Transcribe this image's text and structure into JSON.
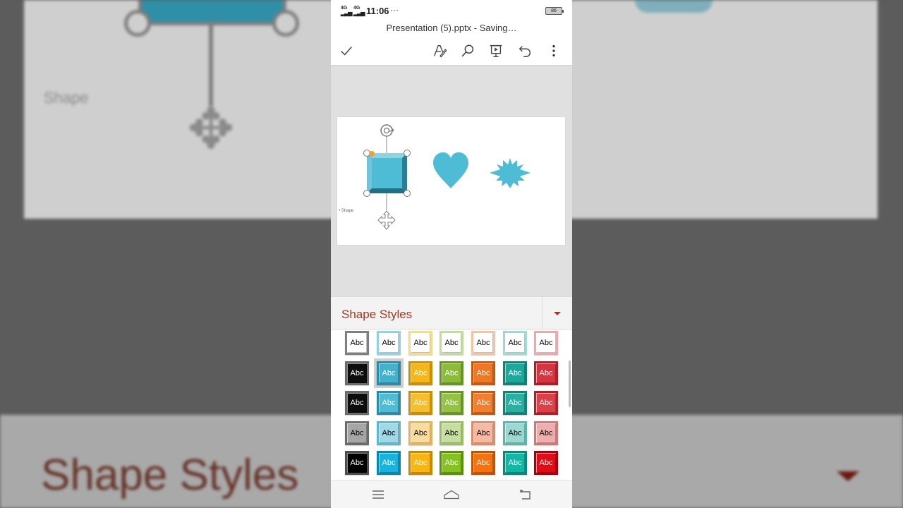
{
  "status": {
    "signal1": "4G",
    "signal2": "4G",
    "time": "11:06",
    "dots": "···",
    "battery": "86"
  },
  "document": {
    "title": "Presentation (5).pptx - Saving…"
  },
  "toolbar": {
    "icons": [
      "check-icon",
      "pen-icon",
      "search-icon",
      "present-icon",
      "undo-icon",
      "more-icon"
    ]
  },
  "slide": {
    "label": "Shape",
    "shape_color": "#4fbcd6"
  },
  "styles": {
    "title": "Shape Styles",
    "accent": "#a4371f",
    "tile_label": "Abc",
    "rows": [
      [
        {
          "bg": "#ffffff",
          "border": "#7f7f7f",
          "text": "#000"
        },
        {
          "bg": "#ffffff",
          "border": "#8fd2e3",
          "text": "#000"
        },
        {
          "bg": "#ffffff",
          "border": "#f6dc84",
          "text": "#000"
        },
        {
          "bg": "#ffffff",
          "border": "#c3dc9a",
          "text": "#000"
        },
        {
          "bg": "#ffffff",
          "border": "#f5c3a0",
          "text": "#000"
        },
        {
          "bg": "#ffffff",
          "border": "#9fd9d3",
          "text": "#000"
        },
        {
          "bg": "#ffffff",
          "border": "#eea7ab",
          "text": "#000"
        }
      ],
      [
        {
          "bg": "#0d0d0d",
          "border": "#6b6b6b",
          "text": "#fff"
        },
        {
          "bg": "#43b1cd",
          "border": "#2d8aa2",
          "text": "#fff"
        },
        {
          "bg": "#f4b619",
          "border": "#c98f06",
          "text": "#fff"
        },
        {
          "bg": "#8cbb3a",
          "border": "#6a9327",
          "text": "#fff"
        },
        {
          "bg": "#ef7723",
          "border": "#c45a11",
          "text": "#fff"
        },
        {
          "bg": "#1da89b",
          "border": "#148076",
          "text": "#fff"
        },
        {
          "bg": "#d6343f",
          "border": "#a8222b",
          "text": "#fff"
        }
      ],
      [
        {
          "bg": "#0d0d0d",
          "border": "#6b6b6b",
          "text": "#fff"
        },
        {
          "bg": "#4fbcd6",
          "border": "#2d8aa2",
          "text": "#fff"
        },
        {
          "bg": "#f6bd2c",
          "border": "#c98f06",
          "text": "#fff"
        },
        {
          "bg": "#95c145",
          "border": "#6a9327",
          "text": "#fff"
        },
        {
          "bg": "#f08030",
          "border": "#c45a11",
          "text": "#fff"
        },
        {
          "bg": "#2ab0a3",
          "border": "#148076",
          "text": "#fff"
        },
        {
          "bg": "#dc4149",
          "border": "#a8222b",
          "text": "#fff"
        }
      ],
      [
        {
          "bg": "#a6a6a6",
          "border": "#6b6b6b",
          "text": "#000"
        },
        {
          "bg": "#9fd9e8",
          "border": "#5fb6cd",
          "text": "#000"
        },
        {
          "bg": "#fbdba0",
          "border": "#e4b45a",
          "text": "#000"
        },
        {
          "bg": "#c6dea0",
          "border": "#9cbd66",
          "text": "#000"
        },
        {
          "bg": "#f7b9a2",
          "border": "#e08a68",
          "text": "#000"
        },
        {
          "bg": "#9cd8d2",
          "border": "#5cb4aa",
          "text": "#000"
        },
        {
          "bg": "#efadad",
          "border": "#cf7878",
          "text": "#000"
        }
      ],
      [
        {
          "bg": "#000000",
          "border": "#4d4d4d",
          "text": "#fff"
        },
        {
          "bg": "#16b4de",
          "border": "#0a86a8",
          "text": "#fff"
        },
        {
          "bg": "#fbb50f",
          "border": "#c98800",
          "text": "#fff"
        },
        {
          "bg": "#85c21f",
          "border": "#5d8f0a",
          "text": "#fff"
        },
        {
          "bg": "#f7720f",
          "border": "#c45300",
          "text": "#fff"
        },
        {
          "bg": "#11b8a6",
          "border": "#08877a",
          "text": "#fff"
        },
        {
          "bg": "#e30b18",
          "border": "#a8000a",
          "text": "#fff"
        }
      ]
    ],
    "selected_row": 1,
    "selected_col": 1
  },
  "background": {
    "title": "Shape Styles",
    "shape_label": "Shape"
  }
}
